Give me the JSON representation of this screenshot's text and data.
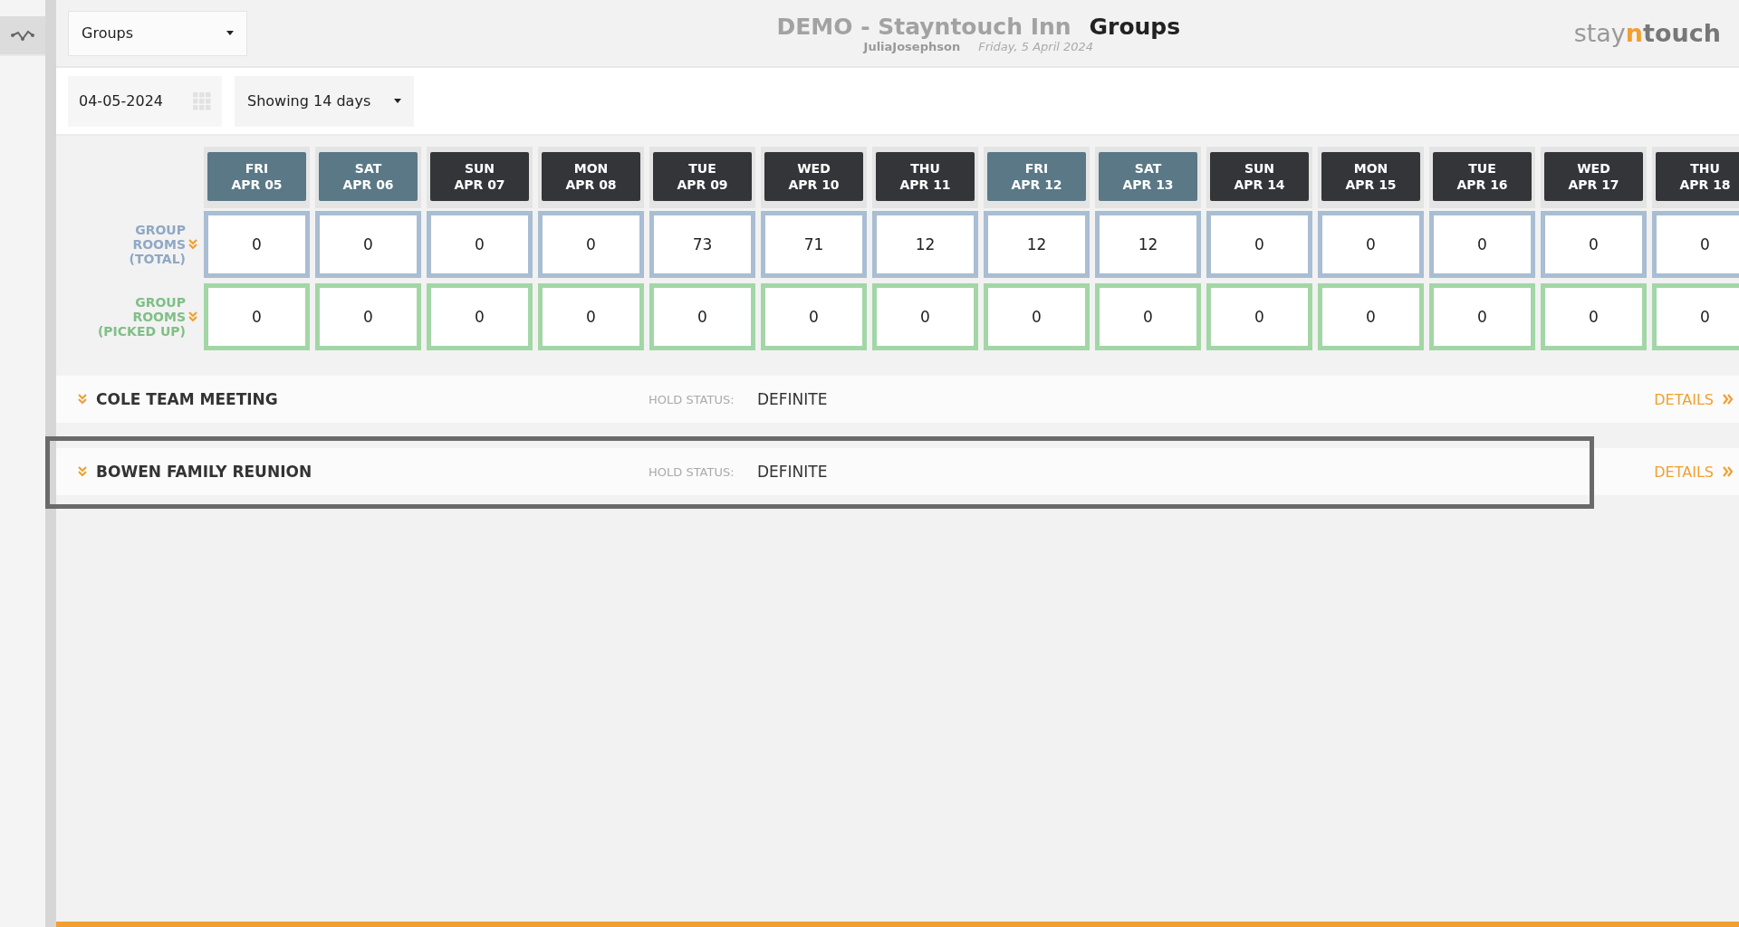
{
  "header": {
    "view_select": "Groups",
    "hotel": "DEMO - Stayntouch Inn",
    "page_title": "Groups",
    "user": "JuliaJosephson",
    "date": "Friday, 5 April 2024",
    "logo": {
      "left": "stay",
      "mid": "n",
      "right": "touch"
    }
  },
  "filters": {
    "date": "04-05-2024",
    "range": "Showing 14 days"
  },
  "days": [
    {
      "day": "FRI",
      "date": "APR 05",
      "weekend": true
    },
    {
      "day": "SAT",
      "date": "APR 06",
      "weekend": true
    },
    {
      "day": "SUN",
      "date": "APR 07",
      "weekend": false
    },
    {
      "day": "MON",
      "date": "APR 08",
      "weekend": false
    },
    {
      "day": "TUE",
      "date": "APR 09",
      "weekend": false
    },
    {
      "day": "WED",
      "date": "APR 10",
      "weekend": false
    },
    {
      "day": "THU",
      "date": "APR 11",
      "weekend": false
    },
    {
      "day": "FRI",
      "date": "APR 12",
      "weekend": true
    },
    {
      "day": "SAT",
      "date": "APR 13",
      "weekend": true
    },
    {
      "day": "SUN",
      "date": "APR 14",
      "weekend": false
    },
    {
      "day": "MON",
      "date": "APR 15",
      "weekend": false
    },
    {
      "day": "TUE",
      "date": "APR 16",
      "weekend": false
    },
    {
      "day": "WED",
      "date": "APR 17",
      "weekend": false
    },
    {
      "day": "THU",
      "date": "APR 18",
      "weekend": false
    }
  ],
  "rows": [
    {
      "kind": "total",
      "label": [
        "GROUP",
        "ROOMS",
        "(TOTAL)"
      ],
      "values": [
        "0",
        "0",
        "0",
        "0",
        "73",
        "71",
        "12",
        "12",
        "12",
        "0",
        "0",
        "0",
        "0",
        "0"
      ]
    },
    {
      "kind": "picked_up",
      "label": [
        "GROUP",
        "ROOMS",
        "(PICKED UP)"
      ],
      "values": [
        "0",
        "0",
        "0",
        "0",
        "0",
        "0",
        "0",
        "0",
        "0",
        "0",
        "0",
        "0",
        "0",
        "0"
      ]
    }
  ],
  "groups": [
    {
      "name": "COLE TEAM MEETING",
      "status_label": "HOLD STATUS:",
      "status": "DEFINITE",
      "link": "DETAILS",
      "selected": false
    },
    {
      "name": "BOWEN FAMILY REUNION",
      "status_label": "HOLD STATUS:",
      "status": "DEFINITE",
      "link": "DETAILS",
      "selected": true
    }
  ]
}
